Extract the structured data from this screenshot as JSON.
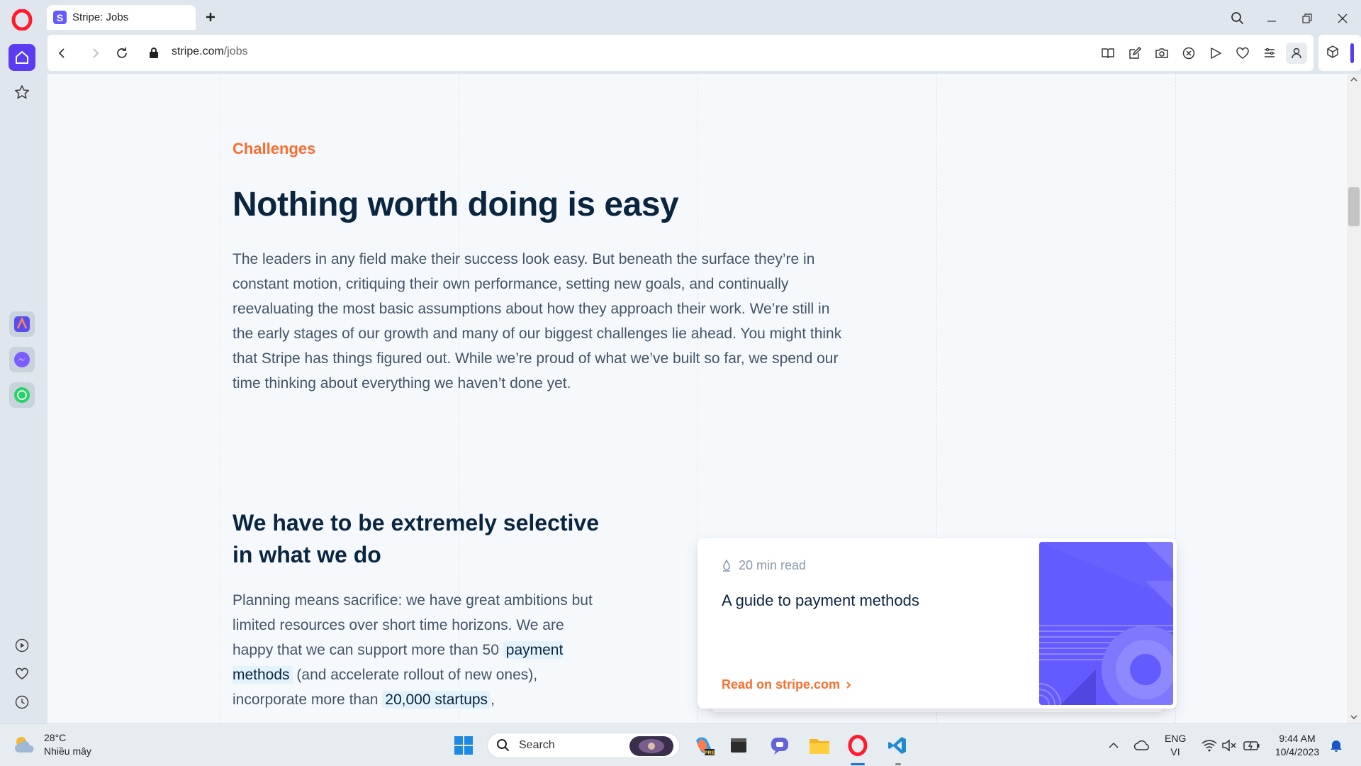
{
  "browser": {
    "tab_title": "Stripe: Jobs",
    "tab_favicon_letter": "S",
    "url_domain": "stripe.com",
    "url_path": "/jobs"
  },
  "content": {
    "eyebrow": "Challenges",
    "heading": "Nothing worth doing is easy",
    "paragraph1": "The leaders in any field make their success look easy. But beneath the surface they’re in constant motion, critiquing their own performance, setting new goals, and continually reevaluating the most basic assumptions about how they approach their work. We’re still in the early stages of our growth and many of our biggest challenges lie ahead. You might think that Stripe has things figured out. While we’re proud of what we’ve built so far, we spend our time thinking about everything we haven’t done yet.",
    "subheading": "We have to be extremely selective in what we do",
    "paragraph2_part1": "Planning means sacrifice: we have great ambitions but limited resources over short time horizons. We are happy that we can support more than 50",
    "paragraph2_link1": "payment methods",
    "paragraph2_part2": "(and accelerate rollout of new ones), incorporate more than",
    "paragraph2_link2": "20,000 startups",
    "paragraph2_part3": ","
  },
  "card": {
    "read_time": "20 min read",
    "title": "A guide to payment methods",
    "link": "Read on stripe.com"
  },
  "taskbar": {
    "temperature": "28°C",
    "weather_desc": "Nhiều mây",
    "search_label": "Search",
    "lang_top": "ENG",
    "lang_bottom": "VI",
    "time": "9:44 AM",
    "date": "10/4/2023"
  },
  "colors": {
    "accent": "#635bff",
    "orange": "#f96e2f",
    "navy": "#0a2540",
    "opera_red": "#ff1b2d"
  }
}
